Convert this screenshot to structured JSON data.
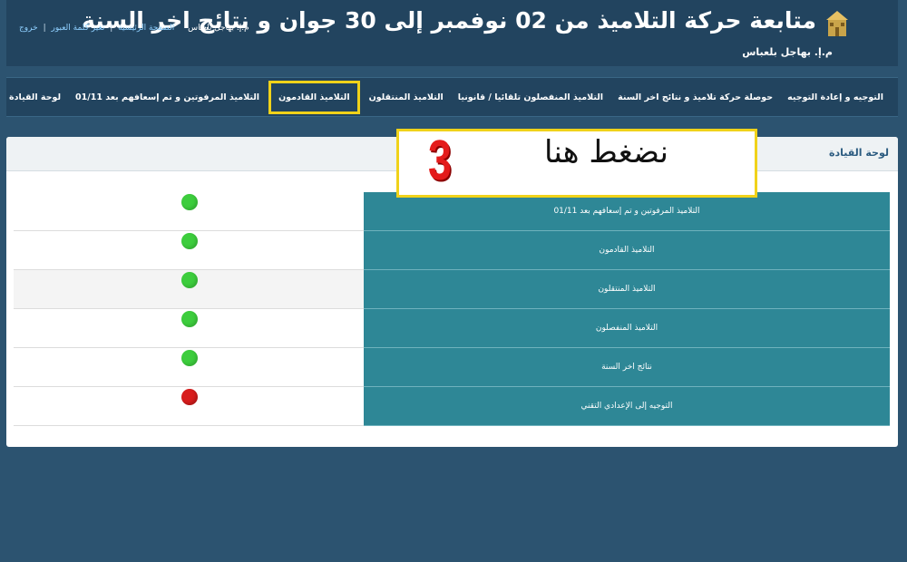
{
  "header": {
    "title": "متابعة حركة التلاميذ من 02 نوفمبر إلى 30 جوان و نتائج اخر السنة",
    "subtitle": "م.إ. بهاجل بلعباس",
    "logo_icon": "school-building-icon"
  },
  "top_links": {
    "user": "م.إ. بهاجل بلعباس",
    "home": "الصفحة الرئيسية",
    "change_password": "تغير كلمة العبور",
    "logout": "خروج",
    "separator": "|"
  },
  "nav": {
    "items": [
      {
        "label": "لوحة القيادة"
      },
      {
        "label": "التلاميذ المرفوتين و تم إسعافهم بعد 01/11"
      },
      {
        "label": "التلاميذ القادمون",
        "active": true
      },
      {
        "label": "التلاميذ المنتقلون"
      },
      {
        "label": "التلاميذ المنفصلون تلقائيا / قانونيا"
      },
      {
        "label": "حوصلة حركة تلاميذ و نتائج اخر السنة"
      },
      {
        "label": "التوجيه و إعادة التوجيه"
      }
    ]
  },
  "panel": {
    "title": "لوحة القيادة",
    "rows": [
      {
        "label": "التلاميذ المرفوتين و تم إسعافهم بعد 01/11",
        "status": "ok"
      },
      {
        "label": "التلاميذ القادمون",
        "status": "ok"
      },
      {
        "label": "التلاميذ المنتقلون",
        "status": "ok"
      },
      {
        "label": "التلاميذ المنفصلون",
        "status": "ok"
      },
      {
        "label": "نتائج اخر السنة",
        "status": "ok"
      },
      {
        "label": "التوجيه إلى الإعدادي التقني",
        "status": "bad"
      }
    ]
  },
  "callout": {
    "text": "نضغط هنا",
    "number": "3"
  },
  "colors": {
    "background": "#2c5370",
    "header": "#22445f",
    "row_label": "#2e8796",
    "highlight": "#f0d21a",
    "status_ok": "#3dcd3d",
    "status_bad": "#d81d1d",
    "callout_number": "#e41b1b"
  }
}
